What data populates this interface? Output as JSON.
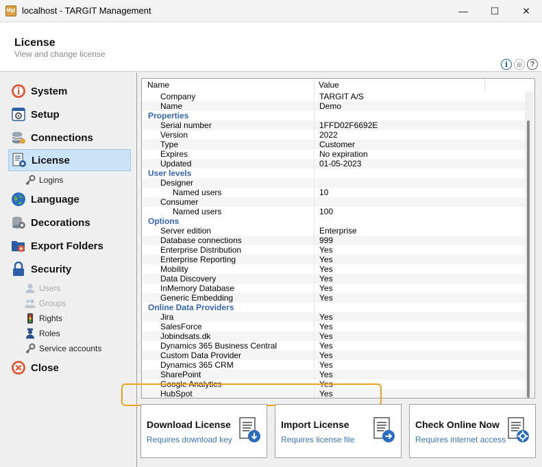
{
  "window": {
    "app_icon_text": "Mgt",
    "title": "localhost - TARGIT Management",
    "minimize": "—",
    "maximize": "☐",
    "close": "✕"
  },
  "header": {
    "title": "License",
    "subtitle": "View and change license",
    "info_glyph": "i",
    "globe_glyph": "⊕",
    "help_glyph": "?"
  },
  "sidebar": {
    "items": [
      {
        "label": "System",
        "icon": "info-icon"
      },
      {
        "label": "Setup",
        "icon": "setup-icon"
      },
      {
        "label": "Connections",
        "icon": "database-icon"
      },
      {
        "label": "License",
        "icon": "license-icon",
        "selected": true
      },
      {
        "label": "Language",
        "icon": "globe-icon"
      },
      {
        "label": "Decorations",
        "icon": "decorations-icon"
      },
      {
        "label": "Export Folders",
        "icon": "folder-icon"
      },
      {
        "label": "Security",
        "icon": "lock-icon"
      },
      {
        "label": "Close",
        "icon": "close-icon"
      }
    ],
    "license_children": [
      {
        "label": "Logins",
        "icon": "key-icon"
      }
    ],
    "security_children": [
      {
        "label": "Users",
        "icon": "user-icon",
        "disabled": true
      },
      {
        "label": "Groups",
        "icon": "group-icon",
        "disabled": true
      },
      {
        "label": "Rights",
        "icon": "traffic-light-icon"
      },
      {
        "label": "Roles",
        "icon": "role-icon"
      },
      {
        "label": "Service accounts",
        "icon": "key-icon"
      }
    ]
  },
  "grid": {
    "headers": {
      "name": "Name",
      "value": "Value"
    },
    "rows": [
      {
        "name": "Company",
        "value": "TARGIT A/S",
        "level": 1
      },
      {
        "name": "Name",
        "value": "Demo",
        "level": 1
      },
      {
        "name": "Properties",
        "value": "",
        "level": 0,
        "category": true
      },
      {
        "name": "Serial number",
        "value": "1FFD02F6692E",
        "level": 1
      },
      {
        "name": "Version",
        "value": "2022",
        "level": 1
      },
      {
        "name": "Type",
        "value": "Customer",
        "level": 1
      },
      {
        "name": "Expires",
        "value": "No expiration",
        "level": 1
      },
      {
        "name": "Updated",
        "value": "01-05-2023",
        "level": 1
      },
      {
        "name": "User levels",
        "value": "",
        "level": 0,
        "category": true
      },
      {
        "name": "Designer",
        "value": "",
        "level": 1
      },
      {
        "name": "Named users",
        "value": "10",
        "level": 2
      },
      {
        "name": "Consumer",
        "value": "",
        "level": 1
      },
      {
        "name": "Named users",
        "value": "100",
        "level": 2
      },
      {
        "name": "Options",
        "value": "",
        "level": 0,
        "category": true
      },
      {
        "name": "Server edition",
        "value": "Enterprise",
        "level": 1
      },
      {
        "name": "Database connections",
        "value": "999",
        "level": 1
      },
      {
        "name": "Enterprise Distribution",
        "value": "Yes",
        "level": 1
      },
      {
        "name": "Enterprise Reporting",
        "value": "Yes",
        "level": 1
      },
      {
        "name": "Mobility",
        "value": "Yes",
        "level": 1
      },
      {
        "name": "Data Discovery",
        "value": "Yes",
        "level": 1
      },
      {
        "name": "InMemory Database",
        "value": "Yes",
        "level": 1
      },
      {
        "name": "Generic Embedding",
        "value": "Yes",
        "level": 1
      },
      {
        "name": "Online Data Providers",
        "value": "",
        "level": 0,
        "category": true
      },
      {
        "name": "Jira",
        "value": "Yes",
        "level": 1
      },
      {
        "name": "SalesForce",
        "value": "Yes",
        "level": 1
      },
      {
        "name": "Jobindsats.dk",
        "value": "Yes",
        "level": 1
      },
      {
        "name": "Dynamics 365 Business Central",
        "value": "Yes",
        "level": 1
      },
      {
        "name": "Custom Data Provider",
        "value": "Yes",
        "level": 1
      },
      {
        "name": "Dynamics 365 CRM",
        "value": "Yes",
        "level": 1
      },
      {
        "name": "SharePoint",
        "value": "Yes",
        "level": 1
      },
      {
        "name": "Google Analytics",
        "value": "Yes",
        "level": 1
      },
      {
        "name": "HubSpot",
        "value": "Yes",
        "level": 1
      }
    ]
  },
  "actions": [
    {
      "title": "Download License",
      "subtitle": "Requires download key"
    },
    {
      "title": "Import License",
      "subtitle": "Requires license file"
    },
    {
      "title": "Check Online Now",
      "subtitle": "Requires internet access"
    }
  ],
  "colors": {
    "accent_blue": "#3465b8",
    "highlight": "#f1a21c",
    "selected_bg": "#cce4f7"
  }
}
